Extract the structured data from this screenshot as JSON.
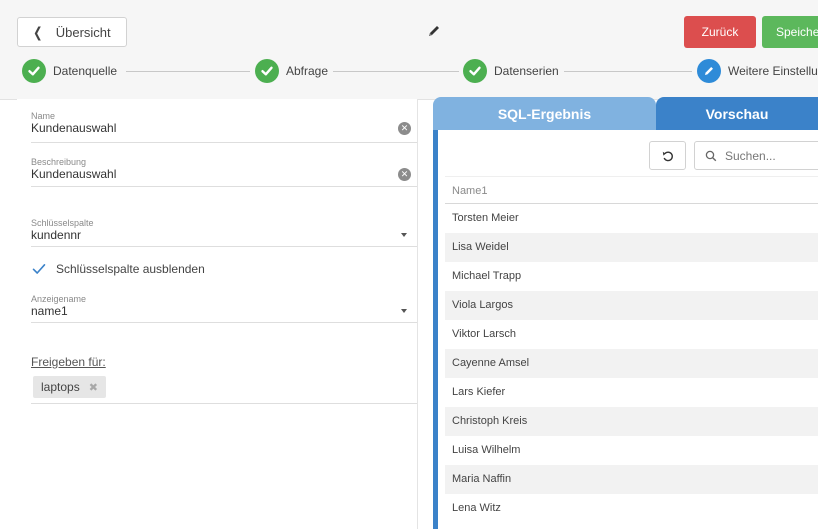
{
  "header": {
    "back_label": "Übersicht",
    "edit_icon": "pencil-icon",
    "btn_back": "Zurück",
    "btn_save": "Speichern"
  },
  "stepper": [
    {
      "label": "Datenquelle",
      "status": "done"
    },
    {
      "label": "Abfrage",
      "status": "done"
    },
    {
      "label": "Datenserien",
      "status": "done"
    },
    {
      "label": "Weitere Einstellungen",
      "status": "active"
    }
  ],
  "form": {
    "name": {
      "label": "Name",
      "value": "Kundenauswahl"
    },
    "description": {
      "label": "Beschreibung",
      "value": "Kundenauswahl"
    },
    "key_column": {
      "label": "Schlüsselspalte",
      "value": "kundennr"
    },
    "hide_key": {
      "label": "Schlüsselspalte ausblenden",
      "checked": true
    },
    "display_name": {
      "label": "Anzeigename",
      "value": "name1"
    },
    "share": {
      "label": "Freigeben für:",
      "chips": [
        "laptops"
      ]
    }
  },
  "panel": {
    "tabs": [
      "SQL-Ergebnis",
      "Vorschau"
    ],
    "active_tab": "Vorschau",
    "search_placeholder": "Suchen...",
    "column": "Name1",
    "rows": [
      "Torsten Meier",
      "Lisa Weidel",
      "Michael Trapp",
      "Viola Largos",
      "Viktor Larsch",
      "Cayenne Amsel",
      "Lars Kiefer",
      "Christoph Kreis",
      "Luisa Wilhelm",
      "Maria Naffin",
      "Lena Witz"
    ]
  },
  "colors": {
    "accent_green": "#4caf50",
    "accent_blue": "#3b82c9",
    "tab_inactive": "#80b2e0",
    "danger": "#dc4e4e",
    "success": "#5cb85c"
  }
}
